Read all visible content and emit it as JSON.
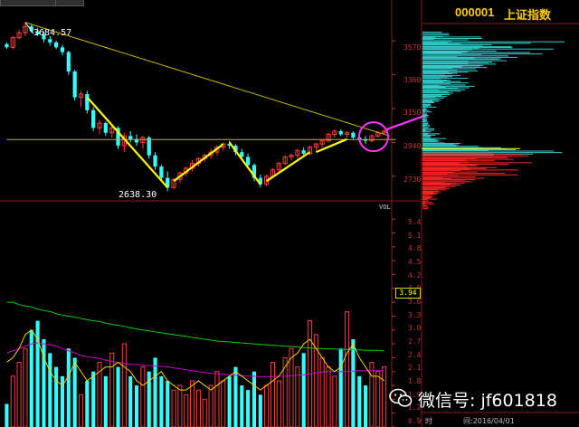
{
  "stock": {
    "code": "000001",
    "name": "上证指数"
  },
  "price_axis": [
    "3570",
    "3360",
    "3150",
    "2940",
    "2730"
  ],
  "volume_panel": {
    "title": "VOL",
    "axis": [
      "5.4",
      "5.1",
      "4.8",
      "4.5",
      "4.2",
      "3.9",
      "3.6",
      "3.3",
      "3.0",
      "2.7",
      "2.4",
      "2.1",
      "1.8",
      "1.5",
      "1.2",
      "0.9"
    ],
    "current": "3.94"
  },
  "annotations": {
    "high": "3684.57",
    "low": "2638.30"
  },
  "bottom": {
    "time_label": "时",
    "date": "间:2016/04/01"
  },
  "watermark": {
    "text": "微信号: jf601818"
  },
  "colors": {
    "up": "#ff3b3b",
    "down": "#33ffff",
    "trendline": "#ffff00",
    "highlight": "#ff33ff",
    "ma1": "#00cc00",
    "ma2": "#cc00cc",
    "ma3": "#ffcc00",
    "axis": "#c83232",
    "profile_up": "#33cccc",
    "profile_down": "#ff2222"
  },
  "chart_data": {
    "type": "candlestick",
    "price_ylim": [
      2600,
      3700
    ],
    "candles": [
      [
        3550,
        3560,
        3520,
        3530
      ],
      [
        3530,
        3600,
        3520,
        3590
      ],
      [
        3590,
        3640,
        3580,
        3620
      ],
      [
        3620,
        3684.57,
        3600,
        3660
      ],
      [
        3660,
        3670,
        3620,
        3630
      ],
      [
        3630,
        3650,
        3600,
        3610
      ],
      [
        3610,
        3630,
        3560,
        3580
      ],
      [
        3580,
        3600,
        3540,
        3560
      ],
      [
        3560,
        3570,
        3520,
        3530
      ],
      [
        3530,
        3545,
        3480,
        3500
      ],
      [
        3500,
        3510,
        3360,
        3380
      ],
      [
        3380,
        3390,
        3200,
        3220
      ],
      [
        3220,
        3260,
        3160,
        3240
      ],
      [
        3240,
        3260,
        3120,
        3140
      ],
      [
        3140,
        3160,
        3010,
        3030
      ],
      [
        3030,
        3080,
        2990,
        3060
      ],
      [
        3060,
        3070,
        2980,
        3000
      ],
      [
        3000,
        3040,
        2970,
        3030
      ],
      [
        3030,
        3040,
        2900,
        2920
      ],
      [
        2920,
        3000,
        2880,
        2980
      ],
      [
        2980,
        3010,
        2940,
        2960
      ],
      [
        2960,
        2990,
        2920,
        2940
      ],
      [
        2940,
        2980,
        2900,
        2970
      ],
      [
        2970,
        2980,
        2840,
        2860
      ],
      [
        2860,
        2880,
        2770,
        2790
      ],
      [
        2790,
        2800,
        2700,
        2720
      ],
      [
        2720,
        2760,
        2638.3,
        2660
      ],
      [
        2660,
        2720,
        2650,
        2710
      ],
      [
        2710,
        2760,
        2690,
        2750
      ],
      [
        2750,
        2790,
        2730,
        2780
      ],
      [
        2780,
        2830,
        2760,
        2810
      ],
      [
        2810,
        2850,
        2790,
        2840
      ],
      [
        2840,
        2870,
        2820,
        2860
      ],
      [
        2860,
        2900,
        2840,
        2880
      ],
      [
        2880,
        2920,
        2860,
        2910
      ],
      [
        2910,
        2940,
        2890,
        2930
      ],
      [
        2930,
        2950,
        2900,
        2920
      ],
      [
        2920,
        2930,
        2860,
        2880
      ],
      [
        2880,
        2900,
        2830,
        2850
      ],
      [
        2850,
        2870,
        2780,
        2800
      ],
      [
        2800,
        2810,
        2700,
        2720
      ],
      [
        2720,
        2740,
        2660,
        2680
      ],
      [
        2680,
        2740,
        2670,
        2730
      ],
      [
        2730,
        2780,
        2720,
        2770
      ],
      [
        2770,
        2820,
        2750,
        2810
      ],
      [
        2810,
        2860,
        2800,
        2850
      ],
      [
        2850,
        2870,
        2830,
        2860
      ],
      [
        2860,
        2900,
        2840,
        2890
      ],
      [
        2890,
        2910,
        2860,
        2870
      ],
      [
        2870,
        2920,
        2860,
        2910
      ],
      [
        2910,
        2940,
        2890,
        2930
      ],
      [
        2930,
        2960,
        2910,
        2950
      ],
      [
        2950,
        3000,
        2940,
        2990
      ],
      [
        2990,
        3020,
        2970,
        3010
      ],
      [
        3010,
        3020,
        2980,
        2990
      ],
      [
        2990,
        3010,
        2970,
        3000
      ],
      [
        3000,
        3010,
        2960,
        2970
      ],
      [
        2970,
        2990,
        2950,
        2960
      ],
      [
        2960,
        2980,
        2930,
        2950
      ],
      [
        2950,
        2990,
        2940,
        2980
      ],
      [
        2980,
        3010,
        2970,
        3000
      ],
      [
        3000,
        3020,
        2990,
        3010
      ]
    ],
    "volumes": [
      1.4,
      2.0,
      2.3,
      2.6,
      3.0,
      3.2,
      2.8,
      2.5,
      2.2,
      2.0,
      2.6,
      2.4,
      1.6,
      1.9,
      2.1,
      2.3,
      2.0,
      2.5,
      2.2,
      2.7,
      2.0,
      1.8,
      2.2,
      2.1,
      2.4,
      2.0,
      1.9,
      1.7,
      1.8,
      1.6,
      1.9,
      1.7,
      1.5,
      1.8,
      2.1,
      1.9,
      2.0,
      2.2,
      1.8,
      1.7,
      2.1,
      1.6,
      1.8,
      2.3,
      1.9,
      2.4,
      2.6,
      2.2,
      2.5,
      3.2,
      2.9,
      2.4,
      2.2,
      2.0,
      2.6,
      3.4,
      2.8,
      2.0,
      1.8,
      2.3,
      2.1,
      2.2
    ],
    "volume_ylim": [
      0.9,
      5.6
    ],
    "volume_ma": {
      "ma1": [
        3.6,
        3.6,
        3.55,
        3.52,
        3.5,
        3.45,
        3.42,
        3.4,
        3.35,
        3.32,
        3.3,
        3.28,
        3.25,
        3.22,
        3.2,
        3.18,
        3.15,
        3.12,
        3.1,
        3.08,
        3.05,
        3.02,
        3.0,
        2.98,
        2.96,
        2.94,
        2.92,
        2.9,
        2.88,
        2.86,
        2.84,
        2.82,
        2.8,
        2.78,
        2.76,
        2.75,
        2.74,
        2.73,
        2.72,
        2.71,
        2.7,
        2.69,
        2.68,
        2.67,
        2.66,
        2.65,
        2.64,
        2.63,
        2.62,
        2.61,
        2.6,
        2.6,
        2.59,
        2.59,
        2.58,
        2.58,
        2.57,
        2.57,
        2.56,
        2.56,
        2.56,
        2.55
      ],
      "ma2": [
        2.5,
        2.55,
        2.6,
        2.65,
        2.7,
        2.72,
        2.7,
        2.68,
        2.65,
        2.6,
        2.55,
        2.5,
        2.45,
        2.42,
        2.4,
        2.38,
        2.35,
        2.32,
        2.3,
        2.28,
        2.26,
        2.25,
        2.24,
        2.23,
        2.22,
        2.21,
        2.2,
        2.18,
        2.16,
        2.14,
        2.12,
        2.1,
        2.08,
        2.06,
        2.05,
        2.04,
        2.03,
        2.02,
        2.01,
        2.0,
        2.0,
        1.99,
        1.99,
        1.99,
        2.0,
        2.0,
        2.01,
        2.02,
        2.03,
        2.05,
        2.07,
        2.09,
        2.1,
        2.1,
        2.1,
        2.1,
        2.11,
        2.12,
        2.12,
        2.12,
        2.12,
        2.12
      ],
      "ma3": [
        2.3,
        2.4,
        2.6,
        2.9,
        3.0,
        2.8,
        2.4,
        2.1,
        1.9,
        1.8,
        2.0,
        2.3,
        2.1,
        1.9,
        2.0,
        2.1,
        2.2,
        2.2,
        2.3,
        2.2,
        2.1,
        1.9,
        1.8,
        1.9,
        2.0,
        2.1,
        1.9,
        1.8,
        1.7,
        1.7,
        1.8,
        1.9,
        1.8,
        1.7,
        1.8,
        1.9,
        2.0,
        2.1,
        2.0,
        1.9,
        1.8,
        1.7,
        1.8,
        1.9,
        2.0,
        2.2,
        2.4,
        2.5,
        2.7,
        2.8,
        2.6,
        2.4,
        2.2,
        2.1,
        2.2,
        2.5,
        2.7,
        2.4,
        2.2,
        2.0,
        2.0,
        1.9
      ]
    },
    "trendlines": [
      {
        "color": "yellow",
        "points": [
          [
            3,
            3684.57
          ],
          [
            61,
            2980
          ]
        ]
      },
      {
        "color": "yellow",
        "points": [
          [
            0,
            2958
          ],
          [
            62,
            2958
          ]
        ]
      }
    ],
    "volume_profile": {
      "price_levels": [
        3680,
        3650,
        3620,
        3590,
        3560,
        3530,
        3500,
        3470,
        3440,
        3410,
        3380,
        3350,
        3320,
        3290,
        3260,
        3230,
        3200,
        3170,
        3140,
        3110,
        3080,
        3050,
        3020,
        2990,
        2960,
        2930,
        2900,
        2870,
        2840,
        2810,
        2780,
        2750,
        2720,
        2690,
        2660,
        2630
      ],
      "volumes": [
        0.18,
        0.4,
        0.95,
        0.78,
        0.62,
        0.55,
        0.48,
        0.42,
        0.36,
        0.3,
        0.34,
        0.28,
        0.2,
        0.16,
        0.12,
        0.06,
        0.04,
        0.03,
        0.04,
        0.05,
        0.08,
        0.12,
        0.22,
        0.55,
        0.92,
        0.7,
        0.6,
        0.72,
        0.62,
        0.4,
        0.32,
        0.25,
        0.18,
        0.12,
        0.08,
        0.04
      ]
    }
  }
}
